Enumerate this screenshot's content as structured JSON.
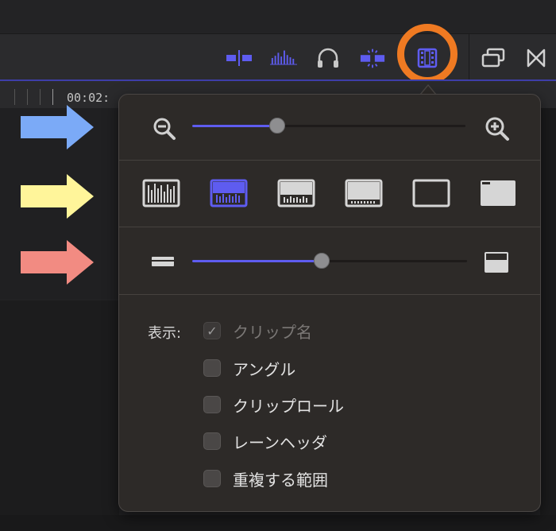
{
  "timeline": {
    "timecode": "00:02:"
  },
  "popover": {
    "zoom": {
      "level": 0.31
    },
    "appearance": {
      "options": [
        {
          "name": "waveforms-only"
        },
        {
          "name": "large-waveforms"
        },
        {
          "name": "waveforms-and-filmstrip"
        },
        {
          "name": "large-filmstrip"
        },
        {
          "name": "filmstrip-only"
        },
        {
          "name": "clip-labels-only"
        }
      ],
      "selected_index": 1
    },
    "clip_height": {
      "level": 0.47
    },
    "display": {
      "label": "表示:",
      "options": [
        {
          "label": "クリップ名",
          "checked": true,
          "enabled": false
        },
        {
          "label": "アングル",
          "checked": false,
          "enabled": true
        },
        {
          "label": "クリップロール",
          "checked": false,
          "enabled": true
        },
        {
          "label": "レーンヘッダ",
          "checked": false,
          "enabled": true
        },
        {
          "label": "重複する範囲",
          "checked": false,
          "enabled": true
        }
      ]
    }
  },
  "colors": {
    "accent": "#5e5cf0",
    "highlight_ring": "#ef7a22",
    "arrow_blue": "#7baaf7",
    "arrow_yellow": "#fff59a",
    "arrow_red": "#f28b82"
  }
}
